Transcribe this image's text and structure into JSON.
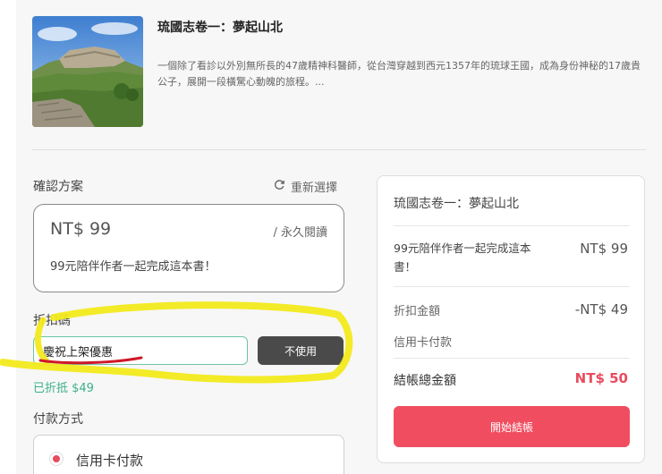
{
  "book": {
    "title": "琉國志卷一：夢起山北",
    "description": "一個除了看診以外別無所長的47歲精神科醫師，從台灣穿越到西元1357年的琉球王國，成為身份神秘的17歲貴公子，展開一段橫驚心動魄的旅程。..."
  },
  "plan": {
    "section_label": "確認方案",
    "reselect_label": "重新選擇",
    "price": "NT$ 99",
    "term": "/ 永久閱讀",
    "description": "99元陪伴作者一起完成這本書！"
  },
  "discount": {
    "section_label": "折扣碼",
    "code_value": "慶祝上架優惠",
    "button_label": "不使用",
    "applied_text": "已折抵 $49"
  },
  "payment": {
    "section_label": "付款方式",
    "option_label": "信用卡付款"
  },
  "summary": {
    "title": "琉國志卷一：夢起山北",
    "item_label": "99元陪伴作者一起完成這本書！",
    "item_price": "NT$ 99",
    "discount_label": "折扣金額",
    "discount_value": "-NT$ 49",
    "payment_method": "信用卡付款",
    "total_label": "結帳總金額",
    "total_value": "NT$ 50",
    "checkout_label": "開始結帳"
  },
  "colors": {
    "accent": "#f04e60",
    "discount_green": "#3bb08a",
    "highlight_yellow": "#f2ea1c",
    "underline_red": "#d0182a"
  },
  "icons": {
    "reselect": "refresh-icon",
    "payment_radio": "radio-selected-icon"
  }
}
